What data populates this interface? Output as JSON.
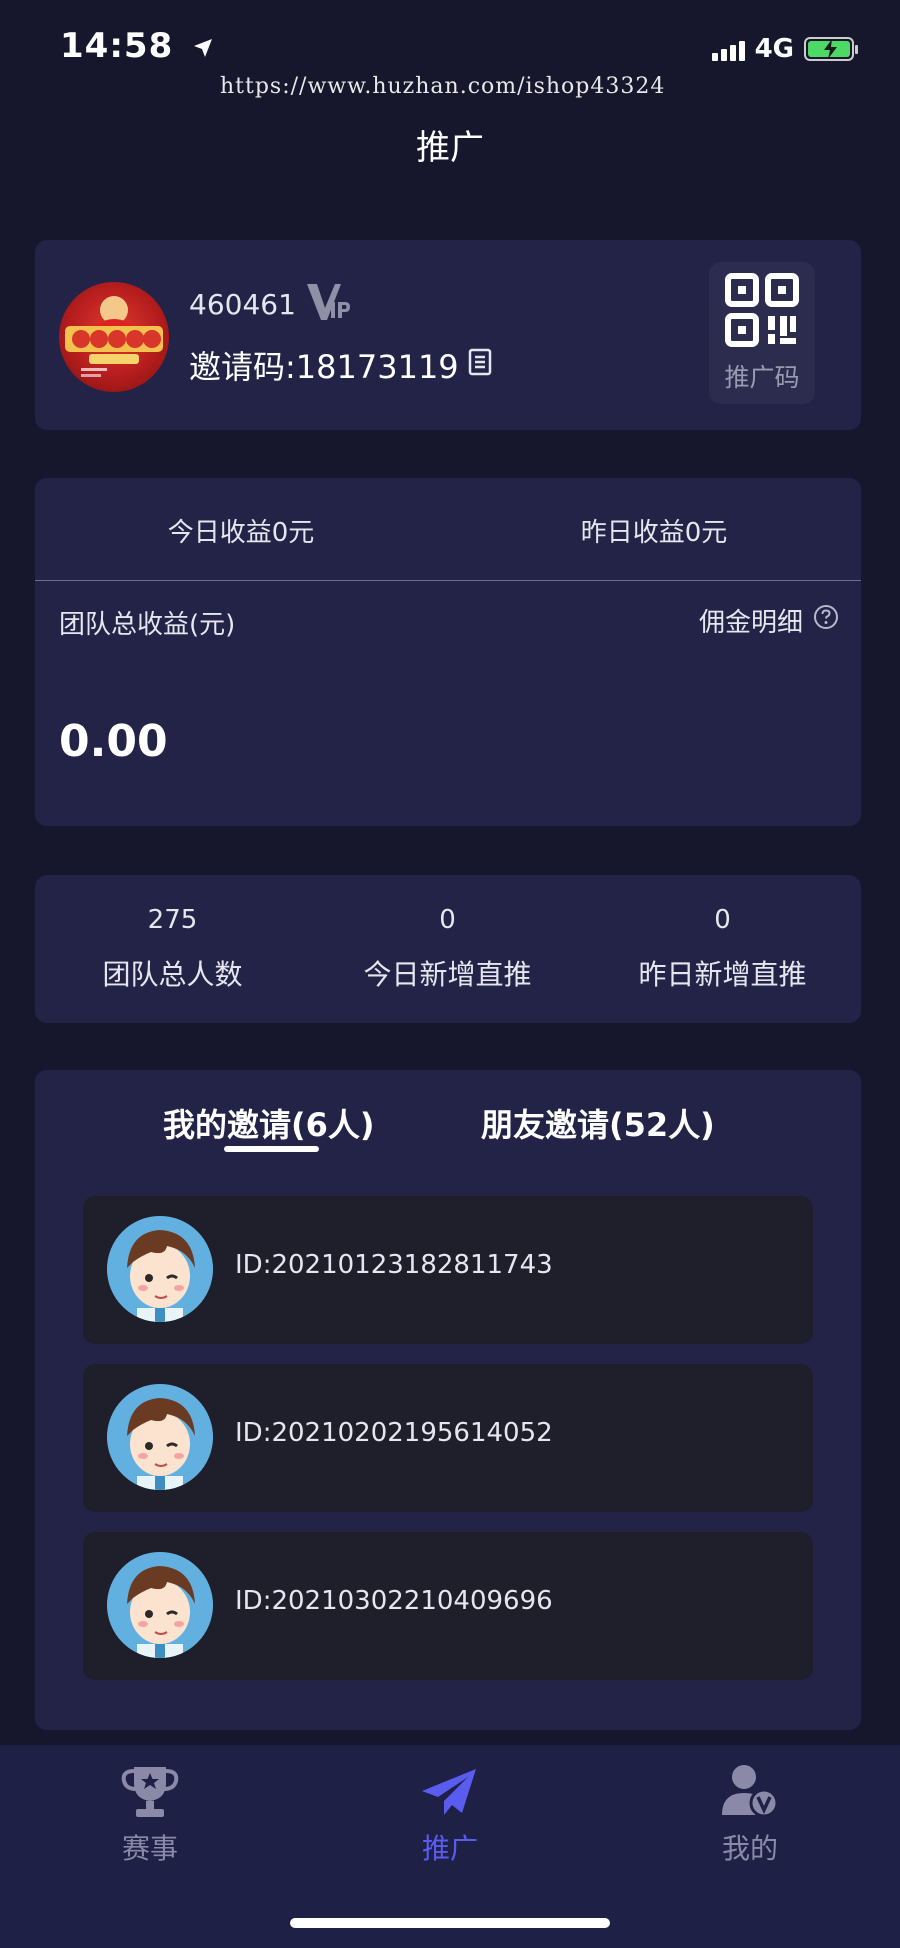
{
  "status_bar": {
    "time": "14:58",
    "network": "4G"
  },
  "watermark": "https://www.huzhan.com/ishop43324",
  "page_title": "推广",
  "profile": {
    "user_id": "460461",
    "vip_badge": "VIP",
    "invite_code": "邀请码:18173119",
    "qr_label": "推广码"
  },
  "earnings": {
    "today": "今日收益0元",
    "yesterday": "昨日收益0元",
    "team_total_label": "团队总收益(元)",
    "commission_detail": "佣金明细",
    "team_total_value": "0.00"
  },
  "stats": [
    {
      "value": "275",
      "label": "团队总人数"
    },
    {
      "value": "0",
      "label": "今日新增直推"
    },
    {
      "value": "0",
      "label": "昨日新增直推"
    }
  ],
  "invites": {
    "tabs": [
      {
        "label": "我的邀请(6人)",
        "active": true
      },
      {
        "label": "朋友邀请(52人)",
        "active": false
      }
    ],
    "items": [
      {
        "id": "ID:20210123182811743"
      },
      {
        "id": "ID:20210202195614052"
      },
      {
        "id": "ID:20210302210409696"
      }
    ]
  },
  "tabbar": {
    "items": [
      {
        "label": "赛事",
        "icon": "trophy-icon",
        "active": false
      },
      {
        "label": "推广",
        "icon": "paper-plane-icon",
        "active": true
      },
      {
        "label": "我的",
        "icon": "user-vip-icon",
        "active": false
      }
    ],
    "active_color": "#5a5cf0",
    "inactive_color": "#8a8aa8"
  }
}
